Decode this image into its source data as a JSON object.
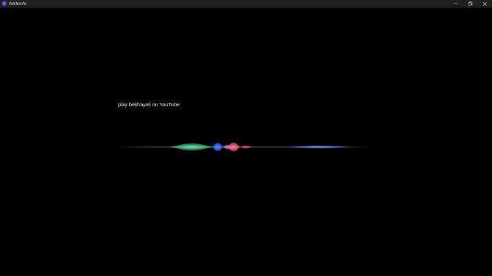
{
  "window": {
    "title": "AetherAI",
    "controls": {
      "minimize": "minimize-icon",
      "maximize": "restore-icon",
      "close": "close-icon"
    }
  },
  "assistant": {
    "transcript": "play bekhayali on YouTube",
    "waveform_colors": {
      "green": "#4ee3a3",
      "blue": "#3d7bff",
      "pink": "#ff5a8a",
      "violet": "#c08bff",
      "light_blue": "#6f8dff"
    }
  }
}
